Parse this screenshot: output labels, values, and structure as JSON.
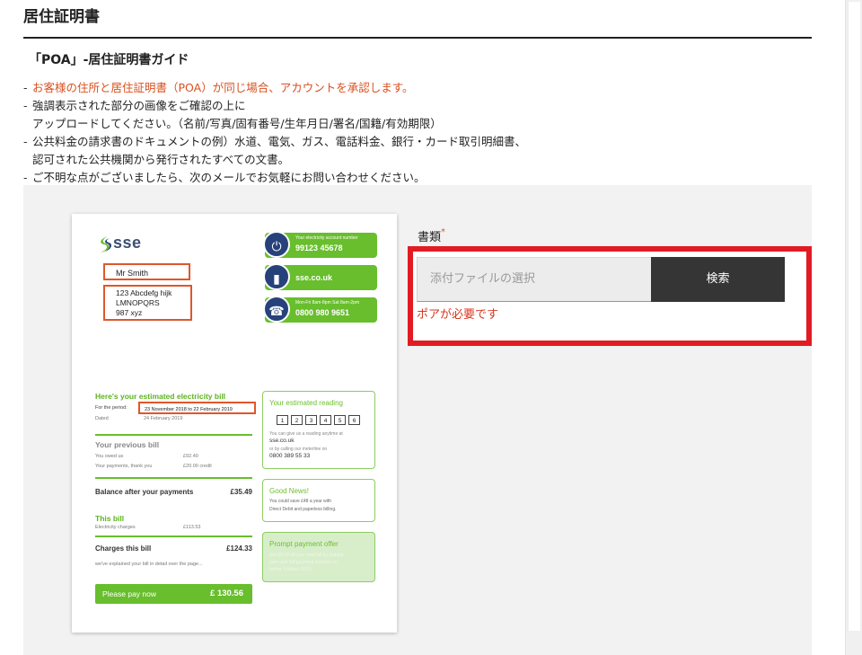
{
  "page": {
    "title": "居住証明書",
    "subtitle": "「POA」-居住証明書ガイド"
  },
  "notes": [
    {
      "line1": "お客様の住所と居住証明書（POA）が同じ場合、アカウントを承認します。",
      "line2": ""
    },
    {
      "line1": "強調表示された部分の画像をご確認の上に",
      "line2": "アップロードしてください。（名前/写真/固有番号/生年月日/署名/国籍/有効期限）"
    },
    {
      "line1": "公共料金の請求書のドキュメントの例）水道、電気、ガス、電話料金、銀行・カード取引明細書、",
      "line2": "認可された公共機関から発行されたすべての文書。"
    },
    {
      "line1": "ご不明な点がございましたら、次のメールでお気軽にお問い合わせください。",
      "line2": ""
    }
  ],
  "bill": {
    "logo": "sse",
    "name": "Mr Smith",
    "address": [
      "123 Abcdefg hijk",
      "LMNOPQRS",
      "987 xyz"
    ],
    "account_label": "Your electricity account number",
    "account_number": "99123 45678",
    "website": "sse.co.uk",
    "hours": "Mon-Fri 8am-8pm Sat 8am-2pm",
    "phone": "0800 980 9651",
    "estimate_heading": "Here's your estimated electricity bill",
    "period_label": "For the period:",
    "period_value": "23 November 2018 to 22 February 2019",
    "dated_label": "Dated",
    "dated_value": "24 February 2019",
    "previous_heading": "Your previous bill",
    "owed_label": "You owed us",
    "owed_value": "£92.40",
    "payments_label": "Your payments, thank you",
    "payments_value": "£20.00 credit",
    "balance_label": "Balance after your payments",
    "balance_value": "£35.49",
    "this_bill_heading": "This bill",
    "charges_label": "Electricity charges",
    "charges_value": "£113.53",
    "charges_total_label": "Charges this bill",
    "charges_total_value": "£124.33",
    "explained": "we've explained your bill in detail over the page...",
    "pay_label": "Please pay now",
    "pay_value": "£ 130.56",
    "reading_heading": "Your estimated reading",
    "reading_digits": [
      "1",
      "2",
      "3",
      "4",
      "5",
      "6"
    ],
    "reading_note": "You can give us a reading anytime at",
    "reading_site": "sse.co.uk",
    "reading_or": "or by calling our meterline on",
    "reading_phone": "0800 389 55 33",
    "good_heading": "Good News!",
    "good_text1": "You could save £48 a year with",
    "good_text2": "Direct Debit and paperless billing.",
    "prompt_heading": "Prompt payment offer",
    "prompt_text1": "Get £5.00 off your next bill by making",
    "prompt_text2": "sure your full payment reaches us",
    "prompt_text3": "before 5 March 2019."
  },
  "form": {
    "doc_label": "書類",
    "required_mark": "*",
    "file_placeholder": "添付ファイルの選択",
    "browse_label": "検索",
    "error": "ポアが必要です"
  },
  "colors": {
    "accent_orange": "#d9501e",
    "error_red": "#e21b23",
    "sse_green": "#68be2c",
    "sse_navy": "#27427a",
    "button_dark": "#353535"
  }
}
